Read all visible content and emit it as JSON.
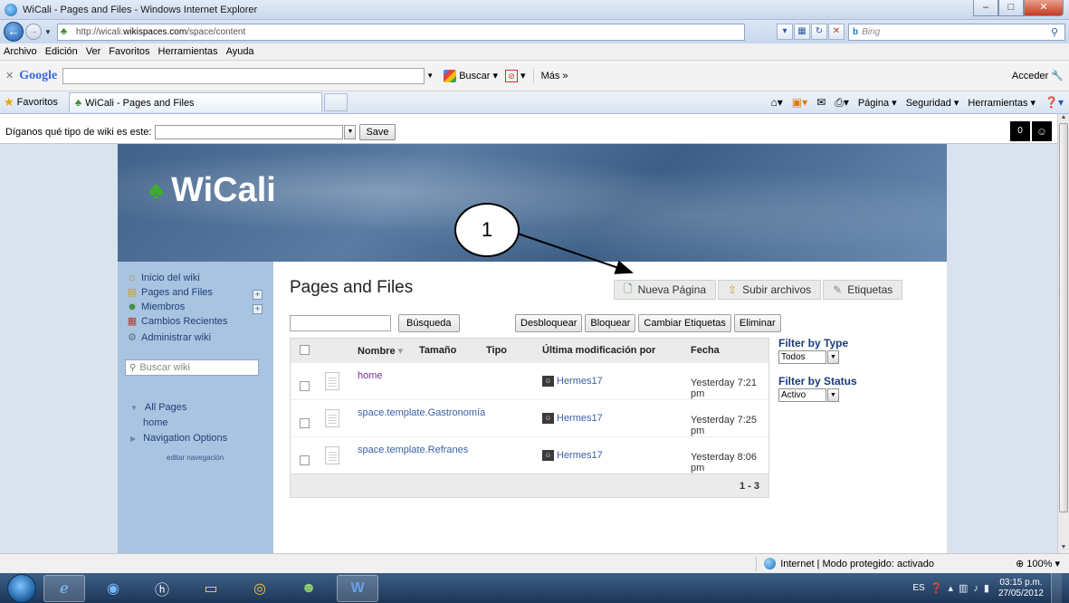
{
  "window": {
    "title": "WiCali - Pages and Files - Windows Internet Explorer"
  },
  "address": {
    "url_prefix": "http://wicali.",
    "url_domain": "wikispaces.com",
    "url_path": "/space/content",
    "search_engine": "Bing",
    "search_placeholder": "Bing"
  },
  "menu": {
    "items": [
      "Archivo",
      "Edición",
      "Ver",
      "Favoritos",
      "Herramientas",
      "Ayuda"
    ]
  },
  "google_toolbar": {
    "logo": "Google",
    "buscar_label": "Buscar",
    "more_label": "Más »",
    "acceder_label": "Acceder"
  },
  "favbar": {
    "favorites_label": "Favoritos",
    "tab_label": "WiCali - Pages and Files",
    "commands": [
      "Página",
      "Seguridad",
      "Herramientas"
    ]
  },
  "wiki_notice": {
    "label": "Díganos qué tipo de wiki es este:",
    "save_label": "Save",
    "counter": "0"
  },
  "wiki": {
    "title": "WiCali",
    "sidebar": {
      "items": [
        {
          "label": "Inicio del wiki",
          "icon": "home-icon",
          "expand": false
        },
        {
          "label": "Pages and Files",
          "icon": "pages-icon",
          "expand": true
        },
        {
          "label": "Miembros",
          "icon": "members-icon",
          "expand": true
        },
        {
          "label": "Cambios Recientes",
          "icon": "calendar-icon",
          "expand": false
        },
        {
          "label": "Administrar wiki",
          "icon": "gear-icon",
          "expand": false
        }
      ],
      "search_placeholder": "Buscar wiki",
      "all_pages": "All Pages",
      "home_link": "home",
      "navigation_options": "Navigation Options",
      "edit_nav": "editar navegación"
    },
    "main": {
      "page_title": "Pages and Files",
      "actions": {
        "new_page": "Nueva Página",
        "upload": "Subir archivos",
        "tags": "Etiquetas"
      },
      "search_button": "Búsqueda",
      "bulk": {
        "unlock": "Desbloquear",
        "lock": "Bloquear",
        "change_tags": "Cambiar Etiquetas",
        "delete": "Eliminar"
      },
      "table": {
        "columns": {
          "name": "Nombre",
          "size": "Tamaño",
          "type": "Tipo",
          "modified_by": "Última modificación por",
          "date": "Fecha"
        },
        "rows": [
          {
            "name": "home",
            "author": "Hermes17",
            "date": "Yesterday 7:21 pm"
          },
          {
            "name": "space.template.Gastronomía",
            "author": "Hermes17",
            "date": "Yesterday 7:25 pm"
          },
          {
            "name": "space.template.Refranes",
            "author": "Hermes17",
            "date": "Yesterday 8:06 pm"
          }
        ],
        "range": "1 - 3"
      },
      "filters": {
        "type_title": "Filter by Type",
        "type_value": "Todos",
        "status_title": "Filter by Status",
        "status_value": "Activo"
      }
    },
    "callout_number": "1"
  },
  "status": {
    "zone": "Internet | Modo protegido: activado",
    "zoom": "100%"
  },
  "taskbar": {
    "lang": "ES",
    "time": "03:15 p.m.",
    "date": "27/05/2012"
  }
}
